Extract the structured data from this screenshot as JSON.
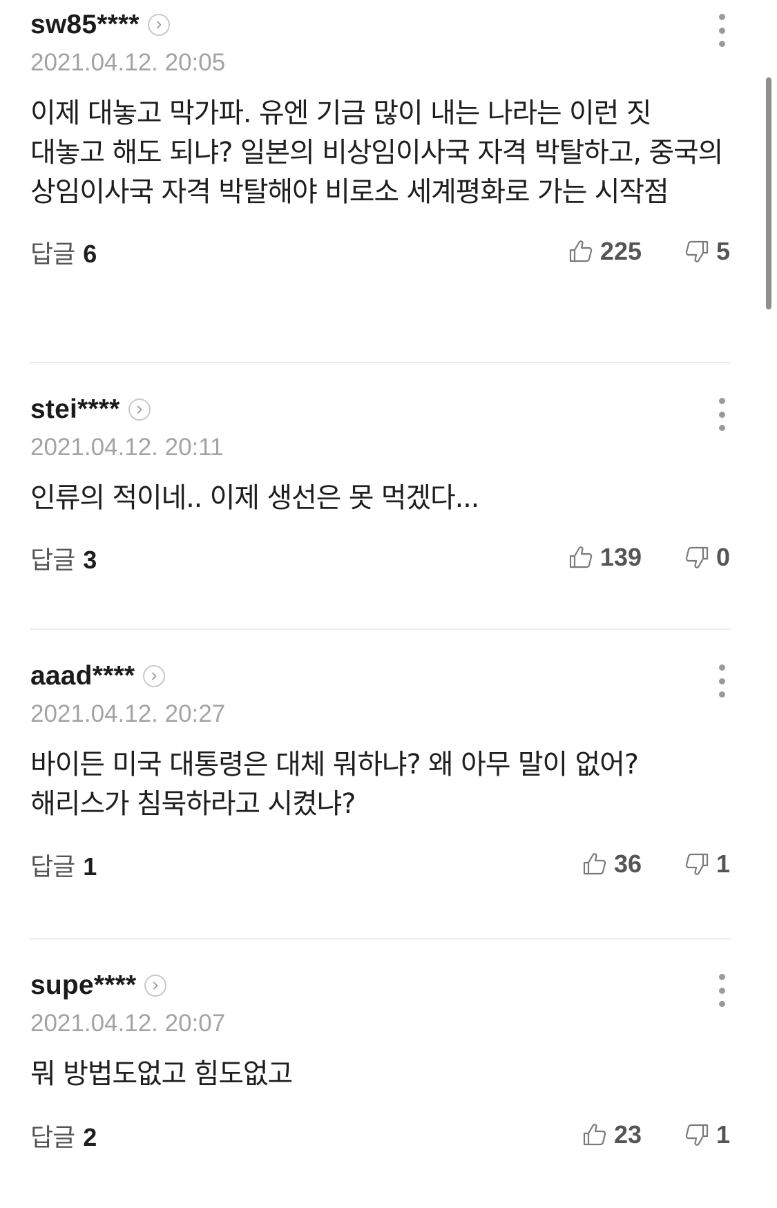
{
  "comments": [
    {
      "username": "sw85****",
      "timestamp": "2021.04.12. 20:05",
      "content": "이제 대놓고 막가파. 유엔 기금 많이 내는 나라는 이런 짓 대놓고 해도 되냐? 일본의 비상임이사국 자격 박탈하고, 중국의 상임이사국 자격 박탈해야 비로소 세계평화로 가는 시작점",
      "reply_label": "답글",
      "reply_count": "6",
      "likes": "225",
      "dislikes": "5"
    },
    {
      "username": "stei****",
      "timestamp": "2021.04.12. 20:11",
      "content": "인류의 적이네.. 이제 생선은 못 먹겠다...",
      "reply_label": "답글",
      "reply_count": "3",
      "likes": "139",
      "dislikes": "0"
    },
    {
      "username": "aaad****",
      "timestamp": "2021.04.12. 20:27",
      "content": "바이든 미국 대통령은 대체 뭐하냐? 왜 아무 말이 없어? 해리스가 침묵하라고 시켰냐?",
      "reply_label": "답글",
      "reply_count": "1",
      "likes": "36",
      "dislikes": "1"
    },
    {
      "username": "supe****",
      "timestamp": "2021.04.12. 20:07",
      "content": "뭐 방법도없고 힘도없고",
      "reply_label": "답글",
      "reply_count": "2",
      "likes": "23",
      "dislikes": "1"
    }
  ],
  "icons": {
    "profile_link": "chevron-right-icon",
    "more": "more-vertical-icon",
    "like": "thumbs-up-icon",
    "dislike": "thumbs-down-icon"
  },
  "colors": {
    "text": "#1e1e1e",
    "muted": "#a3a3a3",
    "secondary": "#555555",
    "divider": "#ececec"
  }
}
